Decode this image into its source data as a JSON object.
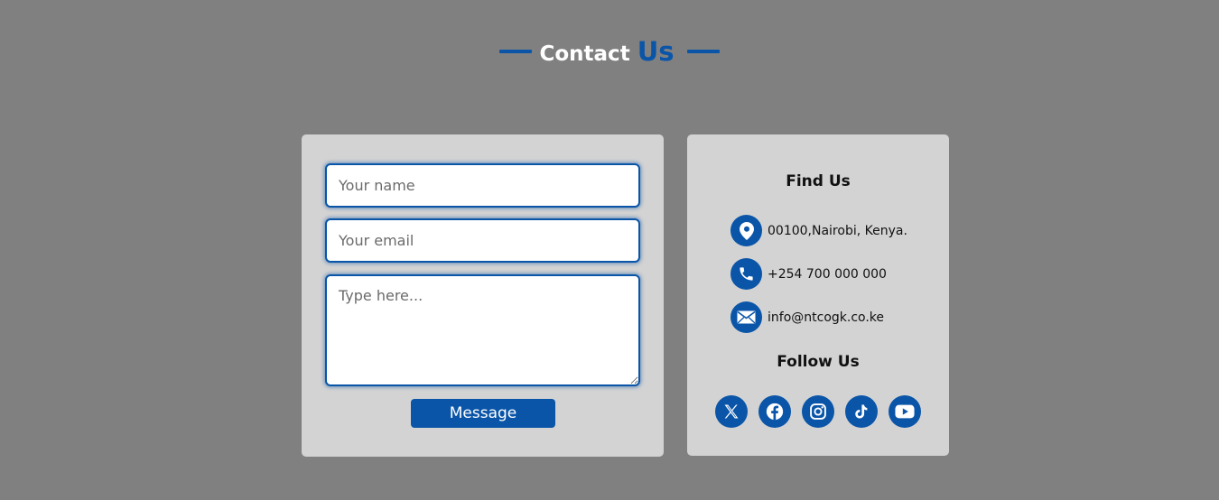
{
  "header": {
    "title_part1": "Contact",
    "title_part2": "Us"
  },
  "form": {
    "name_placeholder": "Your name",
    "email_placeholder": "Your email",
    "message_placeholder": "Type here...",
    "name_value": "",
    "email_value": "",
    "message_value": "",
    "submit_label": "Message"
  },
  "info": {
    "find_title": "Find Us",
    "address": "00100,Nairobi, Kenya.",
    "phone": "+254 700 000 000",
    "email": "info@ntcogk.co.ke",
    "follow_title": "Follow Us",
    "socials": [
      "x-icon",
      "facebook-icon",
      "instagram-icon",
      "tiktok-icon",
      "youtube-icon"
    ]
  },
  "colors": {
    "accent": "#0a55a8",
    "background": "#808080",
    "card": "#d3d3d3"
  }
}
